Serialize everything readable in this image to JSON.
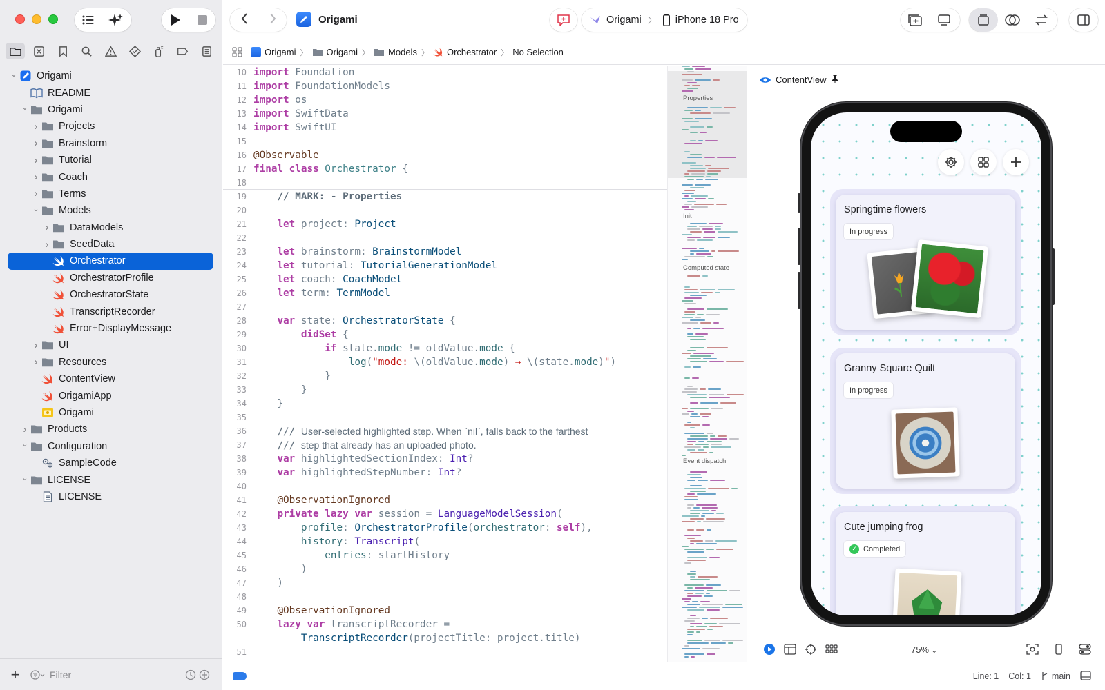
{
  "toolbar": {
    "project_name": "Origami",
    "scheme": "Origami",
    "destination": "iPhone 18 Pro"
  },
  "breadcrumb": [
    "Origami",
    "Origami",
    "Models",
    "Orchestrator",
    "No Selection"
  ],
  "tree": [
    {
      "label": "Origami",
      "depth": 0,
      "icon": "project",
      "chev": "down"
    },
    {
      "label": "README",
      "depth": 1,
      "icon": "book",
      "chev": ""
    },
    {
      "label": "Origami",
      "depth": 1,
      "icon": "folder",
      "chev": "down"
    },
    {
      "label": "Projects",
      "depth": 2,
      "icon": "folder",
      "chev": "right"
    },
    {
      "label": "Brainstorm",
      "depth": 2,
      "icon": "folder",
      "chev": "right"
    },
    {
      "label": "Tutorial",
      "depth": 2,
      "icon": "folder",
      "chev": "right"
    },
    {
      "label": "Coach",
      "depth": 2,
      "icon": "folder",
      "chev": "right"
    },
    {
      "label": "Terms",
      "depth": 2,
      "icon": "folder",
      "chev": "right"
    },
    {
      "label": "Models",
      "depth": 2,
      "icon": "folder",
      "chev": "down"
    },
    {
      "label": "DataModels",
      "depth": 3,
      "icon": "folder",
      "chev": "right"
    },
    {
      "label": "SeedData",
      "depth": 3,
      "icon": "folder",
      "chev": "right"
    },
    {
      "label": "Orchestrator",
      "depth": 3,
      "icon": "swift",
      "chev": "",
      "selected": true
    },
    {
      "label": "OrchestratorProfile",
      "depth": 3,
      "icon": "swift",
      "chev": ""
    },
    {
      "label": "OrchestratorState",
      "depth": 3,
      "icon": "swift",
      "chev": ""
    },
    {
      "label": "TranscriptRecorder",
      "depth": 3,
      "icon": "swift",
      "chev": ""
    },
    {
      "label": "Error+DisplayMessage",
      "depth": 3,
      "icon": "swift",
      "chev": ""
    },
    {
      "label": "UI",
      "depth": 2,
      "icon": "folder",
      "chev": "right"
    },
    {
      "label": "Resources",
      "depth": 2,
      "icon": "folder",
      "chev": "right"
    },
    {
      "label": "ContentView",
      "depth": 2,
      "icon": "swift",
      "chev": ""
    },
    {
      "label": "OrigamiApp",
      "depth": 2,
      "icon": "swift",
      "chev": ""
    },
    {
      "label": "Origami",
      "depth": 2,
      "icon": "entitlement",
      "chev": ""
    },
    {
      "label": "Products",
      "depth": 1,
      "icon": "folder",
      "chev": "right"
    },
    {
      "label": "Configuration",
      "depth": 1,
      "icon": "folder",
      "chev": "down"
    },
    {
      "label": "SampleCode",
      "depth": 2,
      "icon": "config",
      "chev": ""
    },
    {
      "label": "LICENSE",
      "depth": 1,
      "icon": "folder",
      "chev": "down"
    },
    {
      "label": "LICENSE",
      "depth": 2,
      "icon": "doc",
      "chev": ""
    }
  ],
  "sidebar_filter": {
    "placeholder": "Filter"
  },
  "code": [
    {
      "n": "10",
      "t": [
        [
          "kw",
          "import"
        ],
        [
          "pl",
          " Foundation"
        ]
      ]
    },
    {
      "n": "11",
      "t": [
        [
          "kw",
          "import"
        ],
        [
          "pl",
          " FoundationModels"
        ]
      ]
    },
    {
      "n": "12",
      "t": [
        [
          "kw",
          "import"
        ],
        [
          "pl",
          " os"
        ]
      ]
    },
    {
      "n": "13",
      "t": [
        [
          "kw",
          "import"
        ],
        [
          "pl",
          " SwiftData"
        ]
      ]
    },
    {
      "n": "14",
      "t": [
        [
          "kw",
          "import"
        ],
        [
          "pl",
          " SwiftUI"
        ]
      ]
    },
    {
      "n": "15",
      "t": []
    },
    {
      "n": "16",
      "t": [
        [
          "ann",
          "@Observable"
        ]
      ]
    },
    {
      "n": "17",
      "t": [
        [
          "kw",
          "final class"
        ],
        [
          "pl",
          " "
        ],
        [
          "ty2",
          "Orchestrator"
        ],
        [
          "pl",
          " {"
        ]
      ]
    },
    {
      "n": "18",
      "t": [],
      "sep": true
    },
    {
      "n": "19",
      "t": [
        [
          "pl",
          "    "
        ],
        [
          "mark",
          "// MARK: - Properties"
        ]
      ]
    },
    {
      "n": "20",
      "t": []
    },
    {
      "n": "21",
      "t": [
        [
          "pl",
          "    "
        ],
        [
          "kw",
          "let"
        ],
        [
          "pl",
          " project: "
        ],
        [
          "ty",
          "Project"
        ]
      ]
    },
    {
      "n": "22",
      "t": []
    },
    {
      "n": "23",
      "t": [
        [
          "pl",
          "    "
        ],
        [
          "kw",
          "let"
        ],
        [
          "pl",
          " brainstorm: "
        ],
        [
          "ty",
          "BrainstormModel"
        ]
      ]
    },
    {
      "n": "24",
      "t": [
        [
          "pl",
          "    "
        ],
        [
          "kw",
          "let"
        ],
        [
          "pl",
          " tutorial: "
        ],
        [
          "ty",
          "TutorialGenerationModel"
        ]
      ]
    },
    {
      "n": "25",
      "t": [
        [
          "pl",
          "    "
        ],
        [
          "kw",
          "let"
        ],
        [
          "pl",
          " coach: "
        ],
        [
          "ty",
          "CoachModel"
        ]
      ]
    },
    {
      "n": "26",
      "t": [
        [
          "pl",
          "    "
        ],
        [
          "kw",
          "let"
        ],
        [
          "pl",
          " term: "
        ],
        [
          "ty",
          "TermModel"
        ]
      ]
    },
    {
      "n": "27",
      "t": []
    },
    {
      "n": "28",
      "t": [
        [
          "pl",
          "    "
        ],
        [
          "kw",
          "var"
        ],
        [
          "pl",
          " state: "
        ],
        [
          "ty",
          "OrchestratorState"
        ],
        [
          "pl",
          " {"
        ]
      ]
    },
    {
      "n": "29",
      "t": [
        [
          "pl",
          "        "
        ],
        [
          "kw",
          "didSet"
        ],
        [
          "pl",
          " {"
        ]
      ]
    },
    {
      "n": "30",
      "t": [
        [
          "pl",
          "            "
        ],
        [
          "kw",
          "if"
        ],
        [
          "pl",
          " state."
        ],
        [
          "fn",
          "mode"
        ],
        [
          "pl",
          " != oldValue."
        ],
        [
          "fn",
          "mode"
        ],
        [
          "pl",
          " {"
        ]
      ]
    },
    {
      "n": "31",
      "t": [
        [
          "pl",
          "                "
        ],
        [
          "fn",
          "log"
        ],
        [
          "pl",
          "("
        ],
        [
          "str",
          "\"mode: "
        ],
        [
          "pl",
          "\\(oldValue."
        ],
        [
          "fn",
          "mode"
        ],
        [
          "pl",
          ") "
        ],
        [
          "str",
          "→"
        ],
        [
          "pl",
          " \\(state."
        ],
        [
          "fn",
          "mode"
        ],
        [
          "pl",
          ")"
        ],
        [
          "str",
          "\""
        ],
        [
          "pl",
          ")"
        ]
      ]
    },
    {
      "n": "32",
      "t": [
        [
          "pl",
          "            }"
        ]
      ]
    },
    {
      "n": "33",
      "t": [
        [
          "pl",
          "        }"
        ]
      ]
    },
    {
      "n": "34",
      "t": [
        [
          "pl",
          "    }"
        ]
      ]
    },
    {
      "n": "35",
      "t": []
    },
    {
      "n": "36",
      "t": [
        [
          "pl",
          "    "
        ],
        [
          "cm",
          "/// "
        ],
        [
          "doc",
          "User-selected highlighted step. When `nil`, falls back to the farthest"
        ]
      ]
    },
    {
      "n": "37",
      "t": [
        [
          "pl",
          "    "
        ],
        [
          "cm",
          "/// "
        ],
        [
          "doc",
          "step that already has an uploaded photo."
        ]
      ]
    },
    {
      "n": "38",
      "t": [
        [
          "pl",
          "    "
        ],
        [
          "kw",
          "var"
        ],
        [
          "pl",
          " highlightedSectionIndex: "
        ],
        [
          "pr",
          "Int"
        ],
        [
          "pl",
          "?"
        ]
      ]
    },
    {
      "n": "39",
      "t": [
        [
          "pl",
          "    "
        ],
        [
          "kw",
          "var"
        ],
        [
          "pl",
          " highlightedStepNumber: "
        ],
        [
          "pr",
          "Int"
        ],
        [
          "pl",
          "?"
        ]
      ]
    },
    {
      "n": "40",
      "t": []
    },
    {
      "n": "41",
      "t": [
        [
          "pl",
          "    "
        ],
        [
          "ann",
          "@ObservationIgnored"
        ]
      ]
    },
    {
      "n": "42",
      "t": [
        [
          "pl",
          "    "
        ],
        [
          "kw",
          "private lazy var"
        ],
        [
          "pl",
          " session = "
        ],
        [
          "pr",
          "LanguageModelSession"
        ],
        [
          "pl",
          "("
        ]
      ]
    },
    {
      "n": "43",
      "t": [
        [
          "pl",
          "        "
        ],
        [
          "fn",
          "profile"
        ],
        [
          "pl",
          ": "
        ],
        [
          "ty",
          "OrchestratorProfile"
        ],
        [
          "pl",
          "("
        ],
        [
          "fn",
          "orchestrator"
        ],
        [
          "pl",
          ": "
        ],
        [
          "kw",
          "self"
        ],
        [
          "pl",
          "),"
        ]
      ]
    },
    {
      "n": "44",
      "t": [
        [
          "pl",
          "        "
        ],
        [
          "fn",
          "history"
        ],
        [
          "pl",
          ": "
        ],
        [
          "pr",
          "Transcript"
        ],
        [
          "pl",
          "("
        ]
      ]
    },
    {
      "n": "45",
      "t": [
        [
          "pl",
          "            "
        ],
        [
          "fn",
          "entries"
        ],
        [
          "pl",
          ": startHistory"
        ]
      ]
    },
    {
      "n": "46",
      "t": [
        [
          "pl",
          "        )"
        ]
      ]
    },
    {
      "n": "47",
      "t": [
        [
          "pl",
          "    )"
        ]
      ]
    },
    {
      "n": "48",
      "t": []
    },
    {
      "n": "49",
      "t": [
        [
          "pl",
          "    "
        ],
        [
          "ann",
          "@ObservationIgnored"
        ]
      ]
    },
    {
      "n": "50",
      "t": [
        [
          "pl",
          "    "
        ],
        [
          "kw",
          "lazy var"
        ],
        [
          "pl",
          " transcriptRecorder ="
        ]
      ]
    },
    {
      "n": "",
      "t": [
        [
          "pl",
          "        "
        ],
        [
          "ty",
          "TranscriptRecorder"
        ],
        [
          "pl",
          "(projectTitle: project.title)"
        ]
      ]
    },
    {
      "n": "51",
      "t": []
    }
  ],
  "minimap": {
    "labels": [
      "Properties",
      "Init",
      "Computed state",
      "Event dispatch"
    ]
  },
  "preview": {
    "title": "ContentView",
    "zoom": "75%",
    "cards": [
      {
        "title": "Springtime flowers",
        "status": "In progress",
        "completed": false
      },
      {
        "title": "Granny Square Quilt",
        "status": "In progress",
        "completed": false
      },
      {
        "title": "Cute jumping frog",
        "status": "Completed",
        "completed": true
      }
    ]
  },
  "status": {
    "line": "Line: 1",
    "col": "Col: 1",
    "branch": "main"
  },
  "colors": {
    "accent": "#0a63d8",
    "swift": "#f05138",
    "folder": "#7d8590"
  }
}
